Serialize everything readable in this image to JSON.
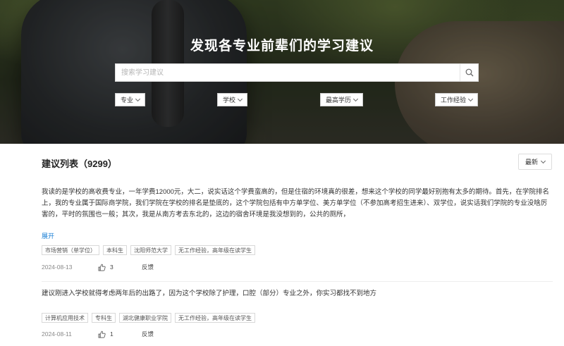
{
  "hero": {
    "title": "发现各专业前辈们的学习建议",
    "search_placeholder": "搜索学习建议",
    "filters": [
      "专业",
      "学校",
      "最高学历",
      "工作经验"
    ]
  },
  "list": {
    "title": "建议列表（9299）",
    "sort": "最新",
    "entries": [
      {
        "text": "我读的是学校的高收费专业，一年学费12000元，大二，说实话这个学费蛮高的，但是住宿的环境真的很差，想来这个学校的同学最好别抱有太多的期待。首先，在学院排名上，我的专业属于国际商学院，我们学院在学校的排名是垫底的，这个学院包括有中方单学位、美方单学位（不参加高考招生进来）、双学位，说实话我们学院的专业没啥厉害的，平时的氛围也一般；其次，我是从南方考去东北的，这边的宿舍环境是我没想到的，公共的厕所，",
        "expand": "展开",
        "tags": [
          "市场营销（单学位）",
          "本科生",
          "沈阳师范大学",
          "无工作经验，高年级在读学生"
        ],
        "date": "2024-08-13",
        "likes": "3",
        "feedback": "反馈"
      },
      {
        "text": "建议刚进入学校就得考虑两年后的出路了，因为这个学校除了护理，口腔（部分）专业之外，你实习都找不到地方",
        "tags": [
          "计算机应用技术",
          "专科生",
          "湖北健康职业学院",
          "无工作经验，高年级在读学生"
        ],
        "date": "2024-08-11",
        "likes": "1",
        "feedback": "反馈"
      }
    ]
  }
}
